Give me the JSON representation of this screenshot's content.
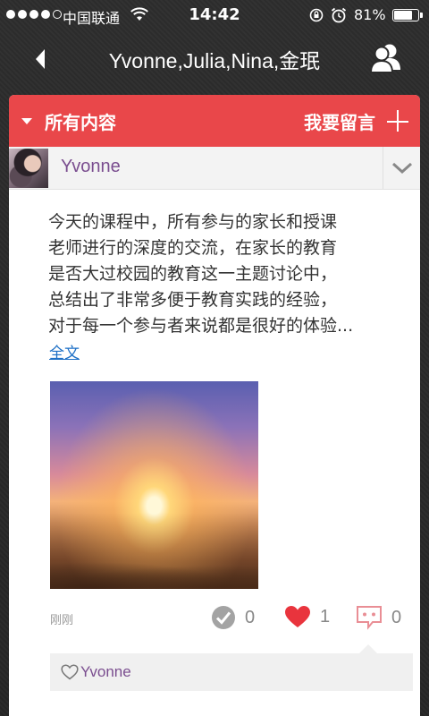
{
  "status_bar": {
    "carrier": "中国联通",
    "time": "14:42",
    "battery_percent": "81%",
    "battery_level": 0.81,
    "signal_bars": 4
  },
  "nav": {
    "title": "Yvonne,Julia,Nina,金珉",
    "back_icon": "chevron-left-icon",
    "group_icon": "group-icon"
  },
  "header": {
    "filter_label": "所有内容",
    "post_label": "我要留言",
    "accent_color": "#e9474a"
  },
  "post": {
    "author": "Yvonne",
    "lines": [
      "今天的课程中，所有参与的家长和授课",
      "老师进行的深度的交流，在家长的教育",
      "是否大过校园的教育这一主题讨论中，",
      "总结出了非常多便于教育实践的经验，",
      "对于每一个参与者来说都是很好的体验..."
    ],
    "full_text_link": "全文",
    "time": "刚刚",
    "checks": "0",
    "likes": "1",
    "comments": "0",
    "liked_by": "Yvonne"
  }
}
